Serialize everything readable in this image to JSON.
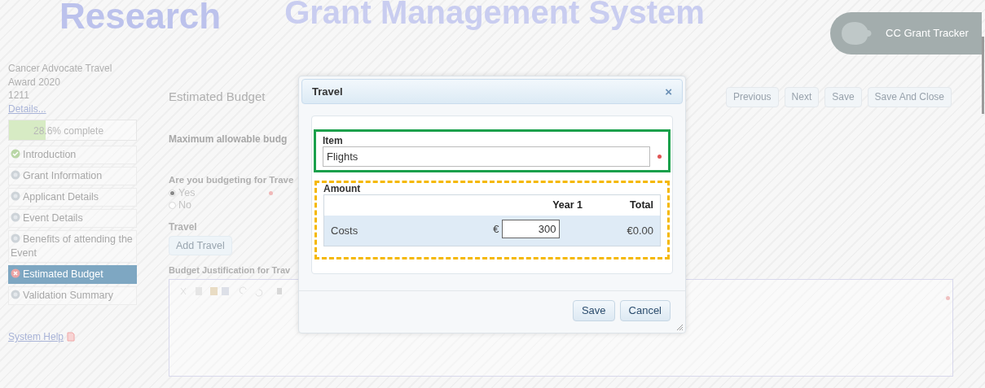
{
  "header": {
    "logo_text": "Research",
    "title": "Grant Management System",
    "badge": "CC Grant Tracker"
  },
  "sidebar": {
    "award_lines": [
      "Cancer Advocate Travel",
      "Award 2020",
      "1211"
    ],
    "details_link": "Details...",
    "progress": {
      "label": "28.6% complete",
      "level": 0.286
    },
    "items": [
      {
        "label": "Introduction",
        "kind": "complete",
        "selected": false
      },
      {
        "label": "Grant Information",
        "kind": "pending",
        "selected": false
      },
      {
        "label": "Applicant Details",
        "kind": "pending",
        "selected": false
      },
      {
        "label": "Event Details",
        "kind": "pending",
        "selected": false
      },
      {
        "label": "Benefits of attending the Event",
        "kind": "pending",
        "selected": false
      },
      {
        "label": "Estimated Budget",
        "kind": "error",
        "selected": true
      },
      {
        "label": "Validation Summary",
        "kind": "pending",
        "selected": false
      }
    ],
    "help_link": "System Help"
  },
  "main": {
    "heading": "Estimated Budget",
    "nav_buttons": [
      "Previous",
      "Next",
      "Save",
      "Save And Close"
    ],
    "max_budget_label": "Maximum allowable budg",
    "question": "Are you budgeting for Trave",
    "options": [
      {
        "label": "Yes",
        "selected": true
      },
      {
        "label": "No",
        "selected": false
      }
    ],
    "travel_label": "Travel",
    "add_button": "Add Travel",
    "justification_label": "Budget Justification for Trav"
  },
  "dialog": {
    "title": "Travel",
    "close": "×",
    "item_label": "Item",
    "item_value": "Flights",
    "amount_label": "Amount",
    "columns": [
      "Year 1",
      "Total"
    ],
    "row": {
      "label": "Costs",
      "currency": "€",
      "value": "300",
      "total": "€0.00"
    },
    "buttons": [
      "Save",
      "Cancel"
    ]
  }
}
